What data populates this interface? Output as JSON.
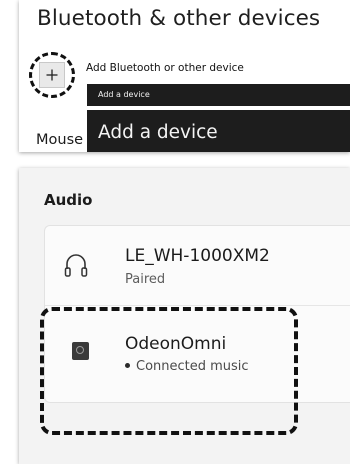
{
  "bluetooth_panel": {
    "title": "Bluetooth & other devices",
    "add_device_label": "Add Bluetooth or other device",
    "mouse_label": "Mouse",
    "tooltip_small": "Add a device",
    "tooltip_large": "Add a device"
  },
  "audio": {
    "title": "Audio",
    "devices": [
      {
        "name": "LE_WH-1000XM2",
        "status": "Paired",
        "icon": "headphones-icon"
      },
      {
        "name": "OdeonOmni",
        "status": "Connected music",
        "icon": "speaker-icon"
      }
    ]
  },
  "colors": {
    "tooltip_bg": "#1d1d1d",
    "card_bg": "#fbfbfb",
    "panel_bg": "#f3f3f3"
  }
}
